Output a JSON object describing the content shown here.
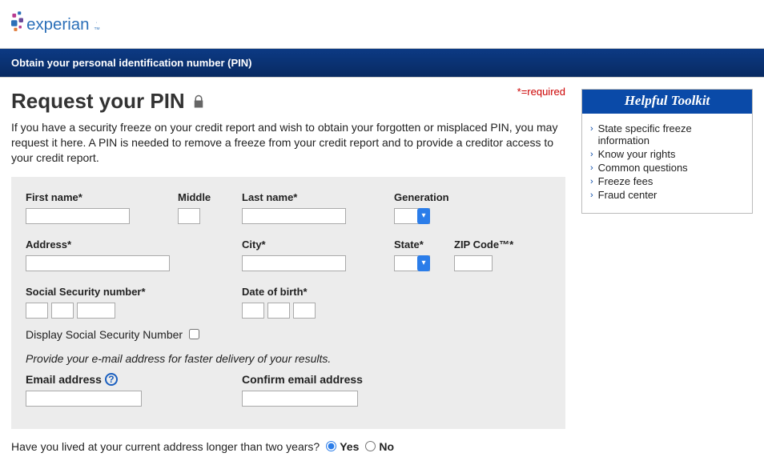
{
  "logo_text": "experian",
  "banner": "Obtain your personal identification number (PIN)",
  "required_note": "*=required",
  "heading": "Request your PIN",
  "intro": "If you have a security freeze on your credit report and wish to obtain your forgotten or misplaced PIN, you may request it here. A PIN is needed to remove a freeze from your credit report and to provide a creditor access to your credit report.",
  "form": {
    "first_name": "First name*",
    "middle": "Middle",
    "last_name": "Last name*",
    "generation": "Generation",
    "address": "Address*",
    "city": "City*",
    "state": "State*",
    "zip": "ZIP Code™*",
    "ssn": "Social Security number*",
    "dob": "Date of birth*",
    "display_ssn": "Display Social Security Number",
    "email_hint": "Provide your e-mail address for faster delivery of your results.",
    "email": "Email address",
    "confirm_email": "Confirm email address"
  },
  "question": {
    "text": "Have you lived at your current address longer than two years?",
    "yes": "Yes",
    "no": "No"
  },
  "toolkit": {
    "title": "Helpful Toolkit",
    "links": [
      "State specific freeze information",
      "Know your rights",
      "Common questions",
      "Freeze fees",
      "Fraud center"
    ]
  }
}
